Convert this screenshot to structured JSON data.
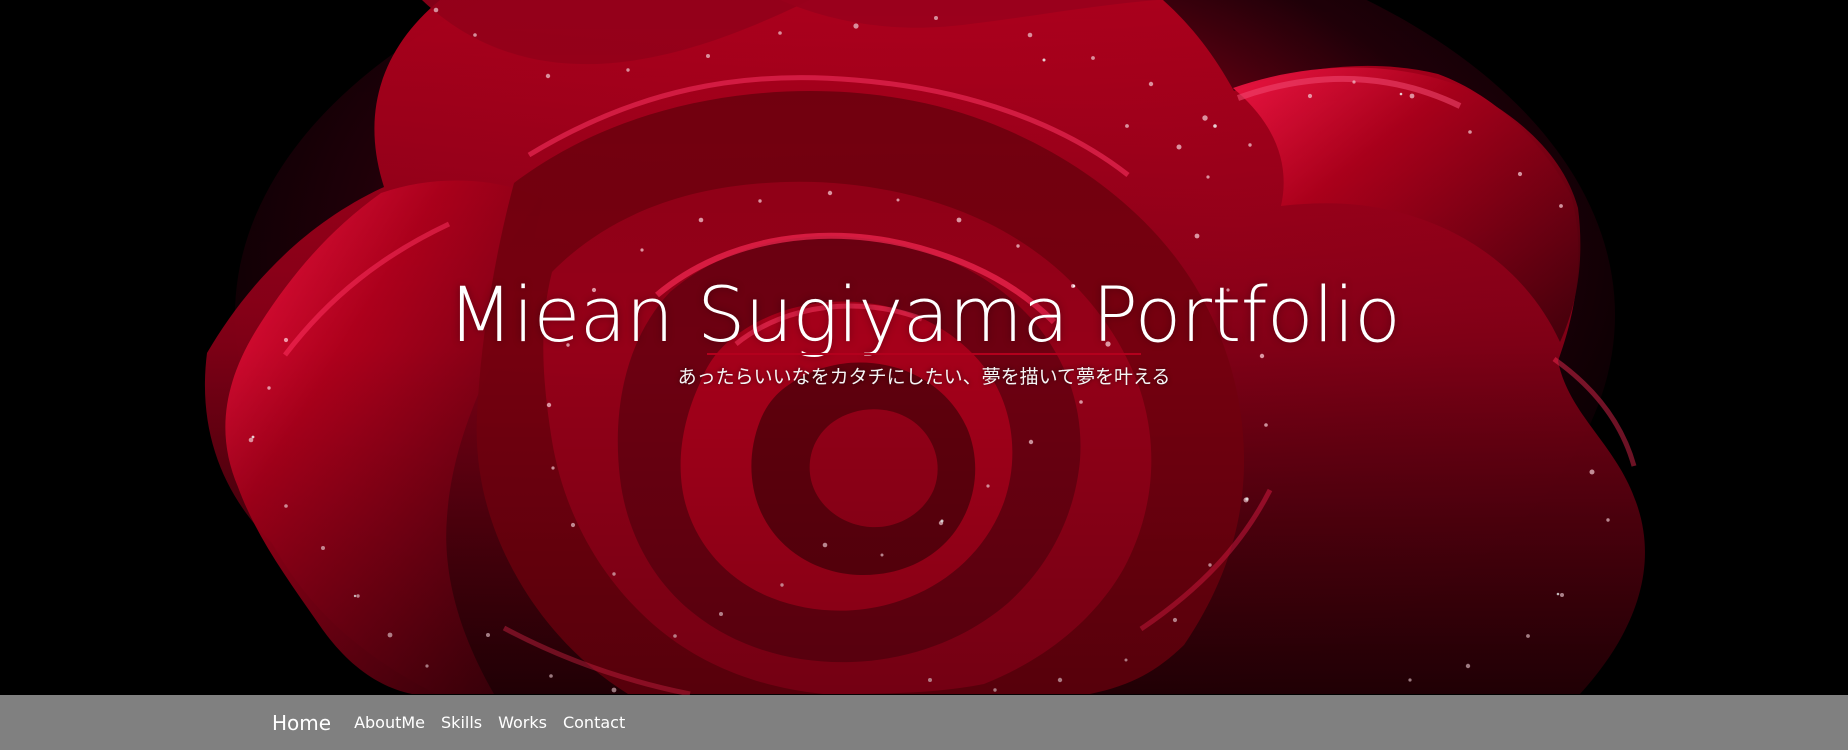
{
  "hero": {
    "title": "Miean Sugiyama Portfolio",
    "subtitle": "あったらいいなをカタチにしたい、夢を描いて夢を叶える",
    "background_image": "red-rose-with-water-droplets"
  },
  "nav": {
    "items": [
      {
        "label": "Home"
      },
      {
        "label": "AboutMe"
      },
      {
        "label": "Skills"
      },
      {
        "label": "Works"
      },
      {
        "label": "Contact"
      }
    ]
  },
  "colors": {
    "navbar_bg": "#808080",
    "accent_rule": "#b3001d",
    "hero_bg": "#000000",
    "rose": "#b00020",
    "text": "#ffffff"
  }
}
